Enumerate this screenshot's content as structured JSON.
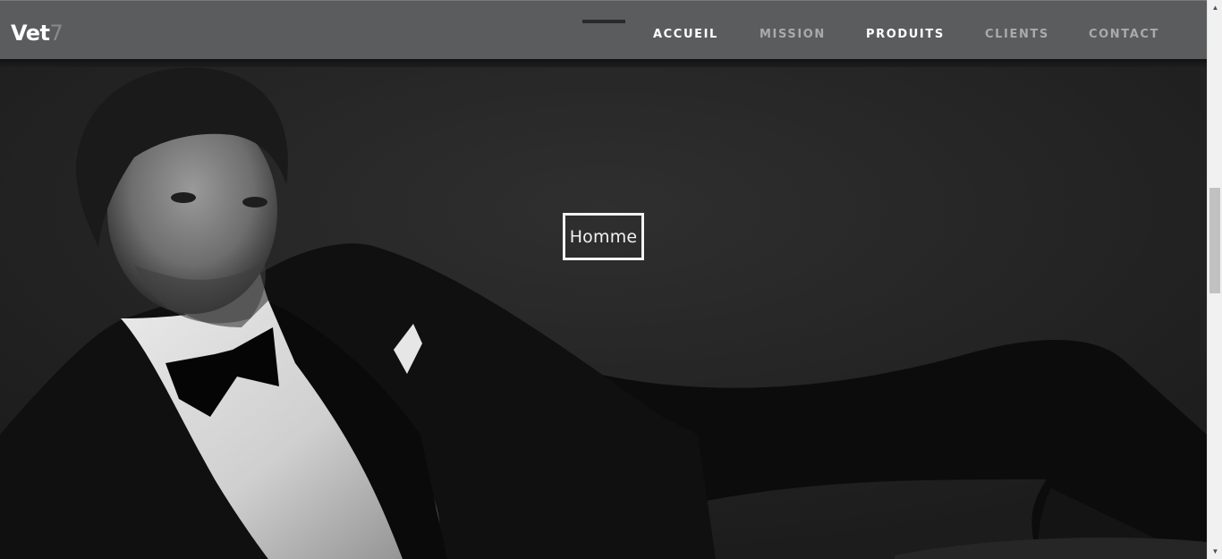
{
  "header": {
    "logo_main": "Vet",
    "logo_accent": "7",
    "nav": [
      {
        "label": "ACCUEIL",
        "active": true
      },
      {
        "label": "MISSION",
        "active": false
      },
      {
        "label": "PRODUITS",
        "active": true
      },
      {
        "label": "CLIENTS",
        "active": false
      },
      {
        "label": "CONTACT",
        "active": false
      }
    ]
  },
  "hero": {
    "label": "Homme"
  },
  "scrollbar": {
    "up_icon": "triangle-up",
    "down_icon": "triangle-down"
  }
}
